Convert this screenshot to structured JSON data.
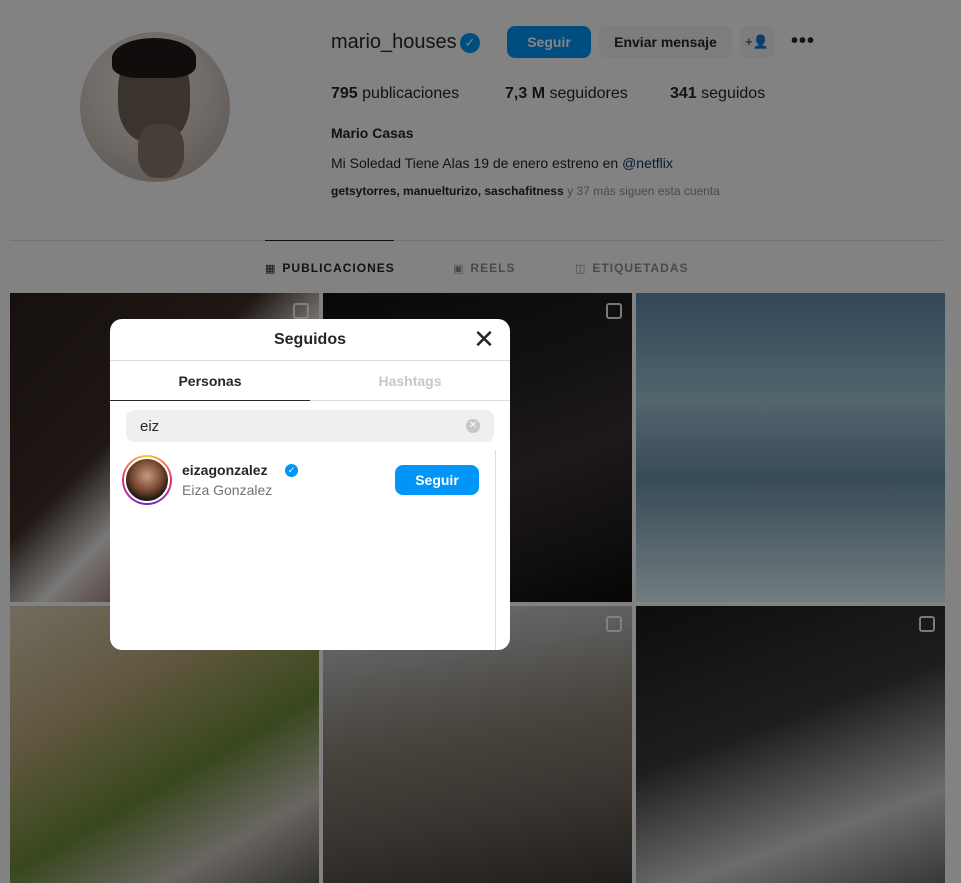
{
  "profile": {
    "username": "mario_houses",
    "follow_label": "Seguir",
    "message_label": "Enviar mensaje",
    "posts_count": "795",
    "posts_label": "publicaciones",
    "followers_count": "7,3 M",
    "followers_label": "seguidores",
    "following_count": "341",
    "following_label": "seguidos",
    "full_name": "Mario Casas",
    "bio_text": "Mi Soledad Tiene Alas 19 de enero estreno en",
    "bio_link": "@netflix",
    "followed_by_users": "getsytorres, manuelturizo, saschafitness",
    "followed_by_suffix": "y 37 más siguen esta cuenta"
  },
  "tabs": [
    {
      "label": "PUBLICACIONES",
      "icon": "grid-icon"
    },
    {
      "label": "REELS",
      "icon": "reels-icon"
    },
    {
      "label": "ETIQUETADAS",
      "icon": "tagged-icon"
    }
  ],
  "modal": {
    "title": "Seguidos",
    "tab_people": "Personas",
    "tab_hashtags": "Hashtags",
    "search_value": "eiz",
    "results": [
      {
        "username": "eizagonzalez",
        "name": "Eiza Gonzalez",
        "follow_label": "Seguir"
      }
    ]
  },
  "colors": {
    "accent": "#0095f6",
    "overlay": "rgba(0,0,0,0.48)"
  }
}
